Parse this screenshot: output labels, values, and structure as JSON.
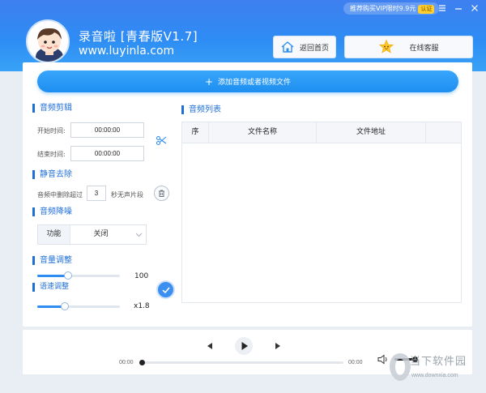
{
  "header": {
    "title": "录音啦 [青春版V1.7]",
    "url": "www.luyinla.com",
    "promo_text": "推荐购买VIP限时9.9元",
    "promo_badge": "认证",
    "window_buttons": [
      "menu-icon",
      "minimize-icon",
      "close-icon"
    ],
    "nav": {
      "home_label": "返回首页",
      "service_label": "在线客服"
    }
  },
  "toolbar": {
    "add_label": "添加音频或者视频文件"
  },
  "audio_cut": {
    "title": "音频剪辑",
    "start_label": "开始时间:",
    "start_value": "00:00:00",
    "end_label": "结束时间:",
    "end_value": "00:00:00"
  },
  "silence": {
    "title": "静音去除",
    "prefix": "音频中删除超过",
    "value": "3",
    "suffix": "秒无声片段"
  },
  "denoise": {
    "title": "音频降噪",
    "function_label": "功能",
    "selected": "关闭"
  },
  "volume": {
    "title": "音量调整",
    "value_label": "100",
    "level": 0.37
  },
  "speed": {
    "title": "语速调整",
    "value_label": "x1.8",
    "level": 0.33
  },
  "list": {
    "title": "音频列表",
    "columns": [
      "序",
      "文件名称",
      "文件地址"
    ]
  },
  "player": {
    "current_time": "00:00",
    "total_time": "00:00",
    "progress": 0,
    "volume": 1
  },
  "watermark": {
    "main": "当下软件园",
    "sub": "www.downxia.com"
  },
  "colors": {
    "accent": "#2f8df2",
    "header_top": "#3f7ff0",
    "header_bottom": "#39a2f7",
    "section_title": "#1f6fd6"
  }
}
